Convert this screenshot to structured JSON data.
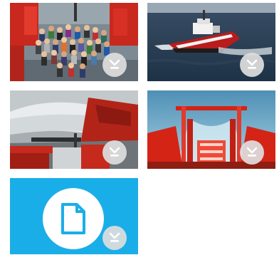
{
  "colors": {
    "file_tile_bg": "#1aaee8",
    "download_button_bg": "#dedede",
    "download_arrow": "#ffffff"
  },
  "tiles": [
    {
      "kind": "photo",
      "icon": "group-photo-on-deck",
      "action_icon": "download-icon"
    },
    {
      "kind": "photo",
      "icon": "ship-at-sea",
      "action_icon": "download-icon"
    },
    {
      "kind": "photo",
      "icon": "ship-bow-in-waves",
      "action_icon": "download-icon"
    },
    {
      "kind": "photo",
      "icon": "ship-deck-crane",
      "action_icon": "download-icon"
    },
    {
      "kind": "file",
      "icon": "document-icon",
      "action_icon": "download-icon"
    }
  ]
}
